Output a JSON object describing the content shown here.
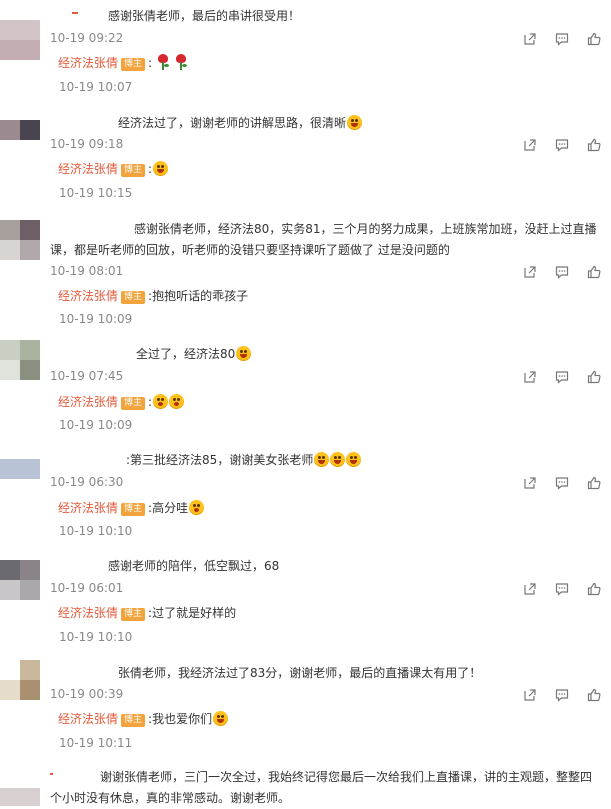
{
  "comments": [
    {
      "author": "",
      "text": "感谢张倩老师，最后的串讲很受用！",
      "time": "10-19 09:22",
      "reply": {
        "name": "经济法张倩",
        "badge": "博主",
        "text": ":",
        "emojis": [
          "rose-icon",
          "rose-icon"
        ],
        "time": "10-19 10:07"
      },
      "avatar_colors": [
        "#ffffff",
        "#c9b7ba"
      ]
    },
    {
      "author": "",
      "text": "经济法过了，谢谢老师的讲解思路，很清晰",
      "text_emoji": "smile-tongue-icon",
      "time": "10-19 09:18",
      "reply": {
        "name": "经济法张倩",
        "badge": "博主",
        "text": ":",
        "emojis": [
          "laugh-icon"
        ],
        "time": "10-19 10:15"
      },
      "avatar_colors": [
        "#9b8a8f",
        "#3f3a45"
      ]
    },
    {
      "author": "",
      "text": "感谢张倩老师，经济法80，实务81，三个月的努力成果，上班族常加班，没赶上过直播课，都是听老师的回放，听老师的没错只要坚持课听了题做了 过是没问题的",
      "time": "10-19 08:01",
      "reply": {
        "name": "经济法张倩",
        "badge": "博主",
        "text": ":抱抱听话的乖孩子",
        "emojis": [],
        "time": "10-19 10:09"
      },
      "avatar_colors": [
        "#a8a09c",
        "#786870"
      ]
    },
    {
      "author": "",
      "text": "全过了，经济法80",
      "text_emoji": "cheer-icon",
      "time": "10-19 07:45",
      "reply": {
        "name": "经济法张倩",
        "badge": "博主",
        "text": ":",
        "emojis": [
          "wow-icon",
          "wow-icon"
        ],
        "time": "10-19 10:09"
      },
      "avatar_colors": [
        "#c9cfc3",
        "#8a9080"
      ]
    },
    {
      "author": "",
      "text": ":第三批经济法85，谢谢美女张老师",
      "text_emoji_count": 3,
      "time": "10-19 06:30",
      "reply": {
        "name": "经济法张倩",
        "badge": "博主",
        "text": ":高分哇",
        "emojis": [
          "wow-icon"
        ],
        "time": "10-19 10:10"
      },
      "avatar_colors": [
        "#ffffff",
        "#b8c3d6"
      ]
    },
    {
      "author": "",
      "text": "感谢老师的陪伴，低空飘过，68",
      "time": "10-19 06:01",
      "reply": {
        "name": "经济法张倩",
        "badge": "博主",
        "text": ":过了就是好样的",
        "emojis": [],
        "time": "10-19 10:10"
      },
      "avatar_colors": [
        "#6a6a70",
        "#aaa8aa"
      ]
    },
    {
      "author": "",
      "text": "张倩老师，我经济法过了83分，谢谢老师，最后的直播课太有用了！",
      "time": "10-19 00:39",
      "reply": {
        "name": "经济法张倩",
        "badge": "博主",
        "text": ":我也爱你们",
        "emojis": [
          "laugh-icon"
        ],
        "time": "10-19 10:11"
      },
      "avatar_colors": [
        "#c9b89c",
        "#a89070"
      ]
    },
    {
      "author": "",
      "text": "谢谢张倩老师，三门一次全过，我始终记得您最后一次给我们上直播课，讲的主观题，整整四个小时没有休息，真的非常感动。谢谢老师。",
      "avatar_colors": [
        "#ffffff",
        "#d8d0d0"
      ]
    }
  ]
}
